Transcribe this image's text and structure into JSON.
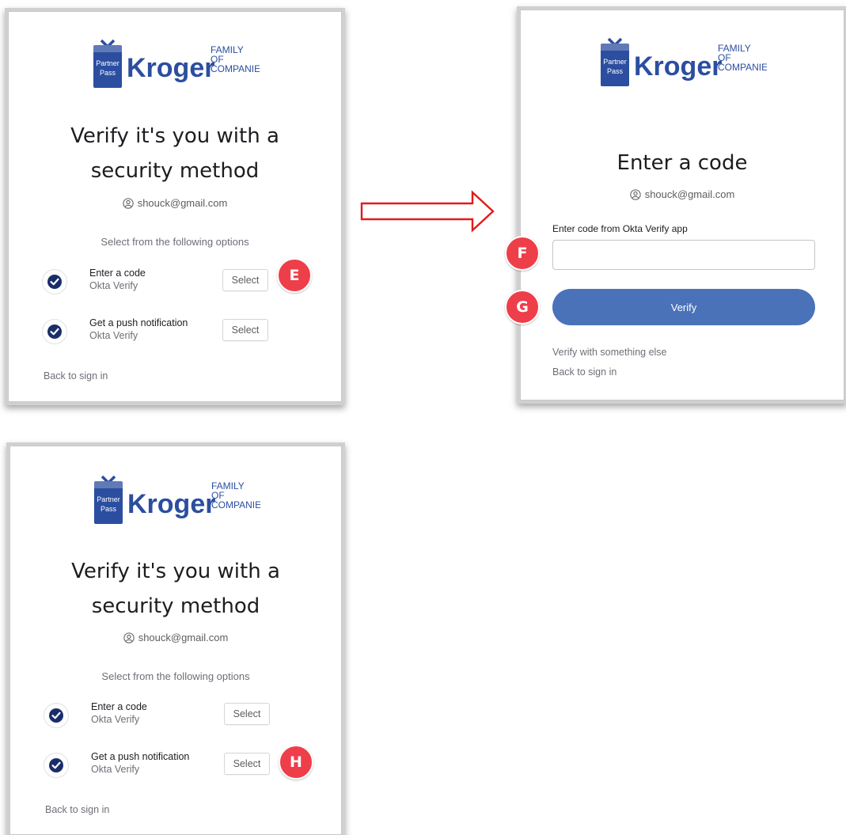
{
  "colors": {
    "brand_blue": "#2b4ea0",
    "verify_button": "#4a72b8",
    "badge_red": "#ee3e4a",
    "arrow_red": "#e11b1b"
  },
  "logo": {
    "badge_line1": "Partner",
    "badge_line2": "Pass",
    "wordmark": "Kroger",
    "tagline1": "FAMILY",
    "tagline2": "OF",
    "tagline3": "COMPANIES"
  },
  "card_select_code": {
    "title_line1": "Verify it's you with a",
    "title_line2": "security method",
    "email": "shouck@gmail.com",
    "subtitle": "Select from the following options",
    "options": [
      {
        "title": "Enter a code",
        "subtitle": "Okta Verify",
        "button": "Select"
      },
      {
        "title": "Get a push notification",
        "subtitle": "Okta Verify",
        "button": "Select"
      }
    ],
    "back_link": "Back to sign in",
    "badge": "E"
  },
  "card_enter_code": {
    "title": "Enter a code",
    "email": "shouck@gmail.com",
    "field_label": "Enter code from Okta Verify app",
    "field_value": "",
    "verify_button": "Verify",
    "alt_link": "Verify with something else",
    "back_link": "Back to sign in",
    "badge_field": "F",
    "badge_button": "G"
  },
  "card_select_push": {
    "title_line1": "Verify it's you with a",
    "title_line2": "security method",
    "email": "shouck@gmail.com",
    "subtitle": "Select from the following options",
    "options": [
      {
        "title": "Enter a code",
        "subtitle": "Okta Verify",
        "button": "Select"
      },
      {
        "title": "Get a push notification",
        "subtitle": "Okta Verify",
        "button": "Select"
      }
    ],
    "back_link": "Back to sign in",
    "badge": "H"
  }
}
